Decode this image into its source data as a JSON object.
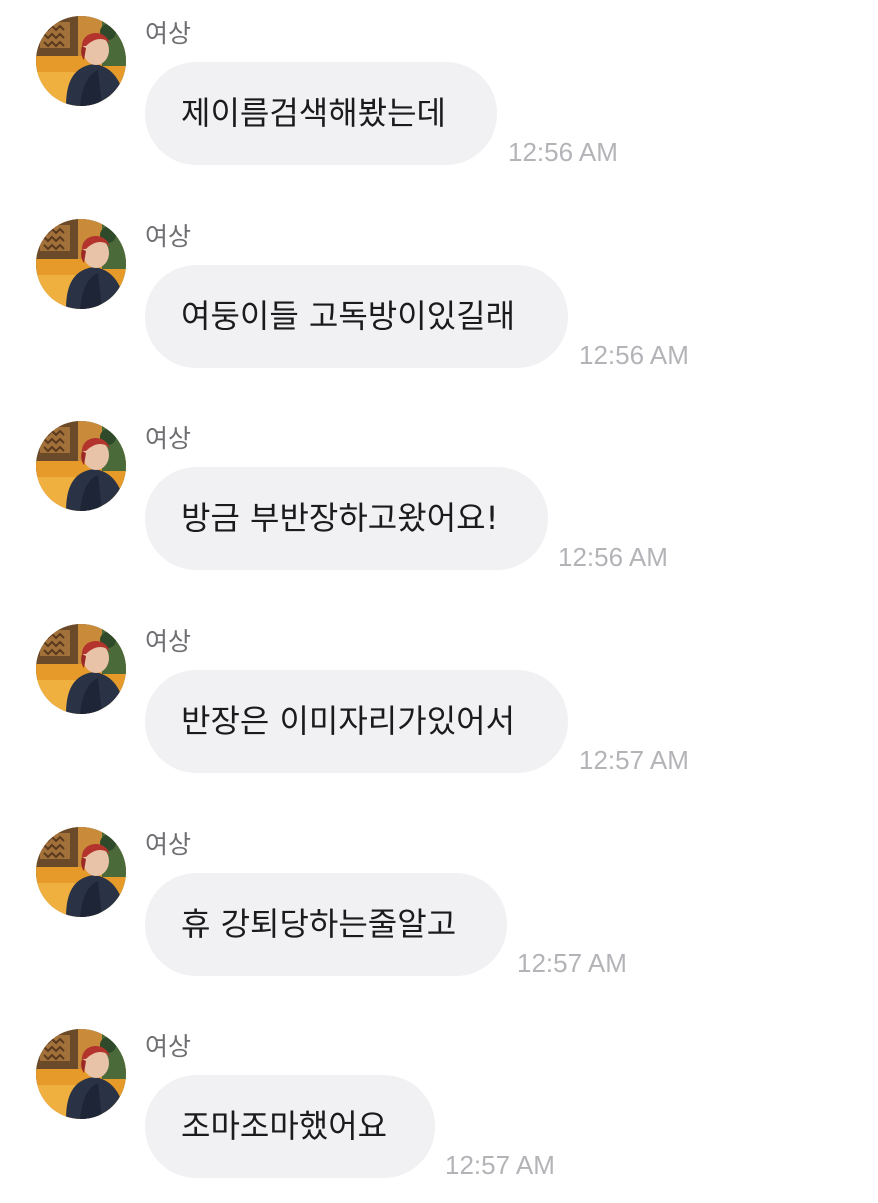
{
  "conversation": {
    "messages": [
      {
        "sender": "여상",
        "text": "제이름검색해봤는데",
        "time": "12:56 AM"
      },
      {
        "sender": "여상",
        "text": "여둥이들 고독방이있길래",
        "time": "12:56 AM"
      },
      {
        "sender": "여상",
        "text": "방금 부반장하고왔어요!",
        "time": "12:56 AM"
      },
      {
        "sender": "여상",
        "text": "반장은 이미자리가있어서",
        "time": "12:57 AM"
      },
      {
        "sender": "여상",
        "text": "휴 강퇴당하는줄알고",
        "time": "12:57 AM"
      },
      {
        "sender": "여상",
        "text": "조마조마했어요",
        "time": "12:57 AM"
      }
    ]
  }
}
